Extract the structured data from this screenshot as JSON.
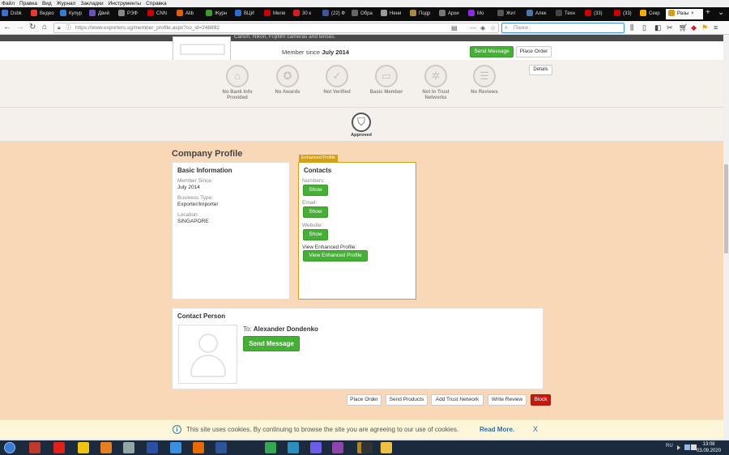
{
  "browser": {
    "menu": [
      "Файл",
      "Правка",
      "Вид",
      "Журнал",
      "Закладки",
      "Инструменты",
      "Справка"
    ],
    "tabs": [
      {
        "label": "Dsbk",
        "color": "#3b6fd4",
        "active": false
      },
      {
        "label": "Видео",
        "color": "#e63b2e",
        "active": false
      },
      {
        "label": "Купур",
        "color": "#2d7fd3",
        "active": false
      },
      {
        "label": "Двий",
        "color": "#6b4fbb",
        "active": false
      },
      {
        "label": "РЭФ",
        "color": "#888888",
        "active": false
      },
      {
        "label": "CNN",
        "color": "#cc0000",
        "active": false
      },
      {
        "label": "Alib",
        "color": "#e65c00",
        "active": false
      },
      {
        "label": "Журн",
        "color": "#3a9a2c",
        "active": false
      },
      {
        "label": "ВЦИ",
        "color": "#2d6bd1",
        "active": false
      },
      {
        "label": "Мили",
        "color": "#cc0000",
        "active": false
      },
      {
        "label": "30 к",
        "color": "#d81b1b",
        "active": false
      },
      {
        "label": "(22) Ф",
        "color": "#3b5998",
        "active": false
      },
      {
        "label": "Обра",
        "color": "#666666",
        "active": false
      },
      {
        "label": "Нени",
        "color": "#999999",
        "active": false
      },
      {
        "label": "Подр",
        "color": "#aa8844",
        "active": false
      },
      {
        "label": "Архи",
        "color": "#777777",
        "active": false
      },
      {
        "label": "Мо",
        "color": "#8a2be2",
        "active": false
      },
      {
        "label": "Жит",
        "color": "#555555",
        "active": false
      },
      {
        "label": "Алек",
        "color": "#4a76a8",
        "active": false
      },
      {
        "label": "Техн",
        "color": "#444444",
        "active": false
      },
      {
        "label": "(33)",
        "color": "#cc0000",
        "active": false
      },
      {
        "label": "(33)",
        "color": "#cc0000",
        "active": false
      },
      {
        "label": "Секр",
        "color": "#ffaa00",
        "active": false
      },
      {
        "label": "Разы",
        "color": "#d4a017",
        "active": true
      }
    ],
    "url": "https://www.exporters.sg/member_profile.aspx?co_id=248892",
    "search_placeholder": "Поиск",
    "close_tab": "×",
    "new_tab": "+"
  },
  "page": {
    "top_desc": "Canon, Nikon, Fujifilm cameras and lenses.",
    "member_since_label": "Member since",
    "member_since_value": "July 2014",
    "send_message_label": "Send Message",
    "place_order_label": "Place Order",
    "details_label": "Details",
    "badges": [
      {
        "line1": "No Bank Info",
        "line2": "Provided",
        "icon": "bank-icon",
        "glyph": "⌂"
      },
      {
        "line1": "No Awards",
        "line2": "",
        "icon": "award-icon",
        "glyph": "✪"
      },
      {
        "line1": "Not Verified",
        "line2": "",
        "icon": "verified-icon",
        "glyph": "✓"
      },
      {
        "line1": "Basic Member",
        "line2": "",
        "icon": "member-icon",
        "glyph": "▭"
      },
      {
        "line1": "Not In Trust",
        "line2": "Networks",
        "icon": "network-icon",
        "glyph": "✲"
      },
      {
        "line1": "No Reviews",
        "line2": "",
        "icon": "review-icon",
        "glyph": "☰"
      }
    ],
    "approved_label": "Approved",
    "approved_icon": "shield-icon",
    "company_profile_title": "Company Profile",
    "basic_info": {
      "title": "Basic Information",
      "member_since_label": "Member Since:",
      "member_since_value": "July 2014",
      "business_type_label": "Business Type:",
      "business_type_value": "Exporter/Importer",
      "location_label": "Location:",
      "location_value": "SINGAPORE"
    },
    "enhanced_tag": "Enhanced Profile",
    "contacts": {
      "title": "Contacts",
      "numbers_label": "Numbers:",
      "email_label": "Email:",
      "website_label": "Website:",
      "show_label": "Show",
      "view_enhanced_label": "View Enhanced Profile:",
      "view_enhanced_button": "View Enhanced Profile"
    },
    "contact_person": {
      "title": "Contact Person",
      "to_label": "To:",
      "name": "Alexander Dondenko",
      "send_message_label": "Send Message"
    },
    "actions": [
      "Place Order",
      "Send Products",
      "Add Trust Network",
      "Write Review"
    ],
    "block_label": "Block",
    "cookie": {
      "info_glyph": "i",
      "text": "This site uses cookies. By continuing to browse the site you are agreeing to our use of cookies.",
      "read_more": "Read More.",
      "close": "X"
    }
  },
  "taskbar": {
    "tray_lang": "RU",
    "time": "13:08",
    "date": "03.09.2020",
    "items": [
      {
        "name": "cyberlink-icon",
        "color": "#c0392b"
      },
      {
        "name": "opera-icon",
        "color": "#e0201b"
      },
      {
        "name": "batman-icon",
        "color": "#f1c40f"
      },
      {
        "name": "media-player-icon",
        "color": "#e67e22"
      },
      {
        "name": "settings-icon",
        "color": "#95a5a6"
      },
      {
        "name": "save-icon",
        "color": "#2c4fa3"
      },
      {
        "name": "ie-icon",
        "color": "#3b8fe0"
      },
      {
        "name": "firefox-icon",
        "color": "#e66a00"
      },
      {
        "name": "word-icon",
        "color": "#2b579a"
      },
      {
        "name": "chrome-icon",
        "color": "#34a853"
      },
      {
        "name": "globe-icon",
        "color": "#2a8fbf"
      },
      {
        "name": "app-icon",
        "color": "#6c5ce7"
      },
      {
        "name": "photos-icon",
        "color": "#8e44ad"
      },
      {
        "name": "game-icon",
        "color": "#b8860b"
      },
      {
        "name": "note-icon",
        "color": "#5b2c6f"
      },
      {
        "name": "g-icon",
        "color": "#333333"
      },
      {
        "name": "explorer-icon",
        "color": "#f0c040"
      }
    ]
  }
}
